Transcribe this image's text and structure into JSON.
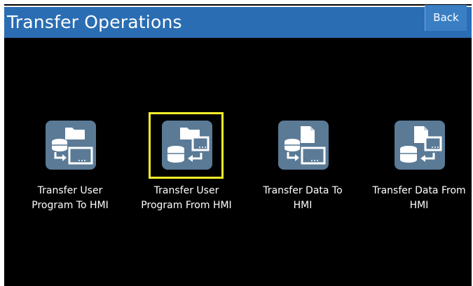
{
  "header": {
    "title": "Transfer Operations",
    "back_label": "Back"
  },
  "colors": {
    "title_bar": "#2a6db3",
    "background": "#000000",
    "icon_tile": "#5a7a96",
    "selection": "#f5ee2a"
  },
  "operations": [
    {
      "label": "Transfer User\nProgram To HMI",
      "icon": "program-to-hmi-icon",
      "selected": false
    },
    {
      "label": "Transfer User\nProgram From HMI",
      "icon": "program-from-hmi-icon",
      "selected": true
    },
    {
      "label": "Transfer Data To\nHMI",
      "icon": "data-to-hmi-icon",
      "selected": false
    },
    {
      "label": "Transfer Data From\nHMI",
      "icon": "data-from-hmi-icon",
      "selected": false
    }
  ]
}
